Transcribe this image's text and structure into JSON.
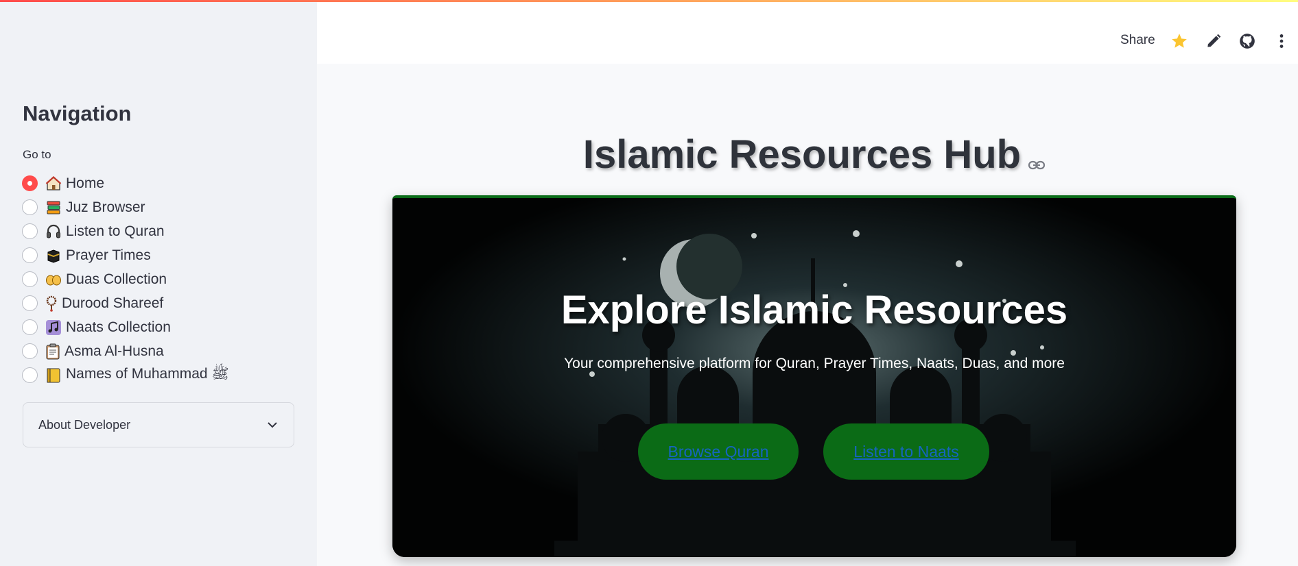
{
  "sidebar": {
    "title": "Navigation",
    "radio_label": "Go to",
    "items": [
      {
        "label": "Home",
        "icon": "house-icon",
        "selected": true
      },
      {
        "label": "Juz Browser",
        "icon": "books-icon",
        "selected": false
      },
      {
        "label": "Listen to Quran",
        "icon": "headphones-icon",
        "selected": false
      },
      {
        "label": "Prayer Times",
        "icon": "kaaba-icon",
        "selected": false
      },
      {
        "label": "Duas Collection",
        "icon": "open-hands-icon",
        "selected": false
      },
      {
        "label": "Durood Shareef",
        "icon": "prayer-beads-icon",
        "selected": false
      },
      {
        "label": "Naats Collection",
        "icon": "music-note-icon",
        "selected": false
      },
      {
        "label": "Asma Al-Husna",
        "icon": "clipboard-icon",
        "selected": false
      },
      {
        "label": "Names of Muhammad ﷺ",
        "icon": "notebook-icon",
        "selected": false
      }
    ],
    "expander_label": "About Developer"
  },
  "header": {
    "share_label": "Share",
    "icons": [
      "star-icon",
      "edit-pencil-icon",
      "github-icon",
      "more-vertical-icon"
    ]
  },
  "main": {
    "title": "Islamic Resources Hub",
    "hero": {
      "title": "Explore Islamic Resources",
      "subtitle": "Your comprehensive platform for Quran, Prayer Times, Naats, Duas, and more",
      "buttons": [
        "Browse Quran",
        "Listen to Naats"
      ]
    }
  },
  "colors": {
    "accent": "#ff4b4b",
    "button_green": "#0b6b16",
    "link_blue": "#1565c0",
    "hero_border": "#0a6b18"
  }
}
